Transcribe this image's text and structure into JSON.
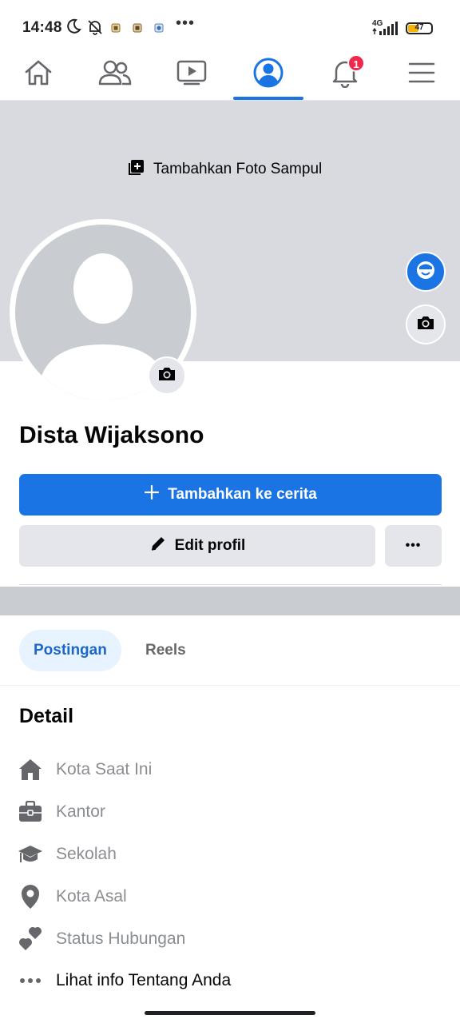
{
  "status_bar": {
    "time": "14:48",
    "overflow": "•••",
    "network": "4G",
    "battery_level": "47",
    "battery_fraction": 0.47,
    "icons": [
      "moon-icon",
      "mute-bell-icon",
      "app-notification-icon",
      "app-notification-icon",
      "app-notification-icon",
      "signal-icon",
      "battery-icon"
    ]
  },
  "top_nav": {
    "tabs": [
      "home-icon",
      "friends-icon",
      "video-icon",
      "profile-icon",
      "bell-icon",
      "menu-icon"
    ],
    "active_tab": "profile-icon",
    "notification_count": "1"
  },
  "cover": {
    "add_cover_label": "Tambahkan Foto Sampul"
  },
  "profile": {
    "name": "Dista Wijaksono"
  },
  "actions": {
    "add_story_label": "Tambahkan ke cerita",
    "edit_profile_label": "Edit profil",
    "more_label": "•••"
  },
  "tabs": {
    "posts": "Postingan",
    "reels": "Reels"
  },
  "details": {
    "title": "Detail",
    "items": [
      {
        "icon": "house-icon",
        "label": "Kota Saat Ini"
      },
      {
        "icon": "briefcase-icon",
        "label": "Kantor"
      },
      {
        "icon": "graduation-cap-icon",
        "label": "Sekolah"
      },
      {
        "icon": "location-pin-icon",
        "label": "Kota Asal"
      },
      {
        "icon": "hearts-icon",
        "label": "Status Hubungan"
      },
      {
        "icon": "more-dots-icon",
        "label": "Lihat info Tentang Anda"
      }
    ]
  },
  "colors": {
    "accent": "#1b74e4",
    "cover": "#d8dadf",
    "badge": "#f02849",
    "tab_active_bg": "#e7f3ff"
  }
}
